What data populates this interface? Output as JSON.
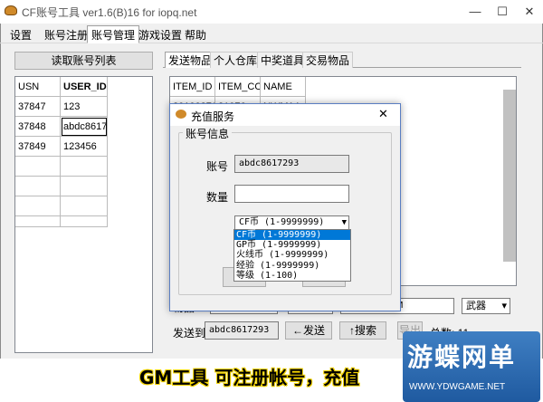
{
  "window": {
    "title": "CF账号工具 ver1.6(B)16 for iopq.net",
    "minimize": "—",
    "maximize": "☐",
    "close": "✕"
  },
  "menu": [
    "设置",
    "账号注册",
    "账号管理",
    "游戏设置",
    "帮助"
  ],
  "left": {
    "read_button": "读取账号列表",
    "columns": [
      "USN",
      "USER_ID"
    ],
    "rows": [
      [
        "37847",
        "123"
      ],
      [
        "37848",
        "abdc8617293"
      ],
      [
        "37849",
        "123456"
      ]
    ]
  },
  "tabs": [
    "发送物品",
    "个人仓库",
    "中奖道具",
    "交易物品"
  ],
  "item_table": {
    "columns": [
      "ITEM_ID",
      "ITEM_CO",
      "NAME"
    ],
    "partial_row": [
      "20100276",
      "21076",
      "NWM14"
    ]
  },
  "dialog": {
    "title": "充值服务",
    "close": "✕",
    "group_label": "账号信息",
    "account_label": "账号",
    "account_value": "abdc8617293",
    "amount_label": "数量",
    "currency_selected": "CF币 (1-9999999)",
    "options": [
      "CF币 (1-9999999)",
      "GP币 (1-9999999)",
      "火线币 (1-9999999)",
      "经验 (1-9999999)",
      "等级 (1-100)"
    ]
  },
  "bottom": {
    "item_id_label": "物品ID",
    "gm_value": "GM",
    "category": "武器",
    "send_to_label": "发送到",
    "send_to_value": "abdc8617293",
    "send_button": "←发送",
    "search_button": "↑搜索",
    "export_button": "导出",
    "total_label": "总数: 11"
  },
  "caption": "GM工具 可注册帐号，充值",
  "watermark": {
    "name": "游蝶网单",
    "url": "WWW.YDWGAME.NET"
  }
}
